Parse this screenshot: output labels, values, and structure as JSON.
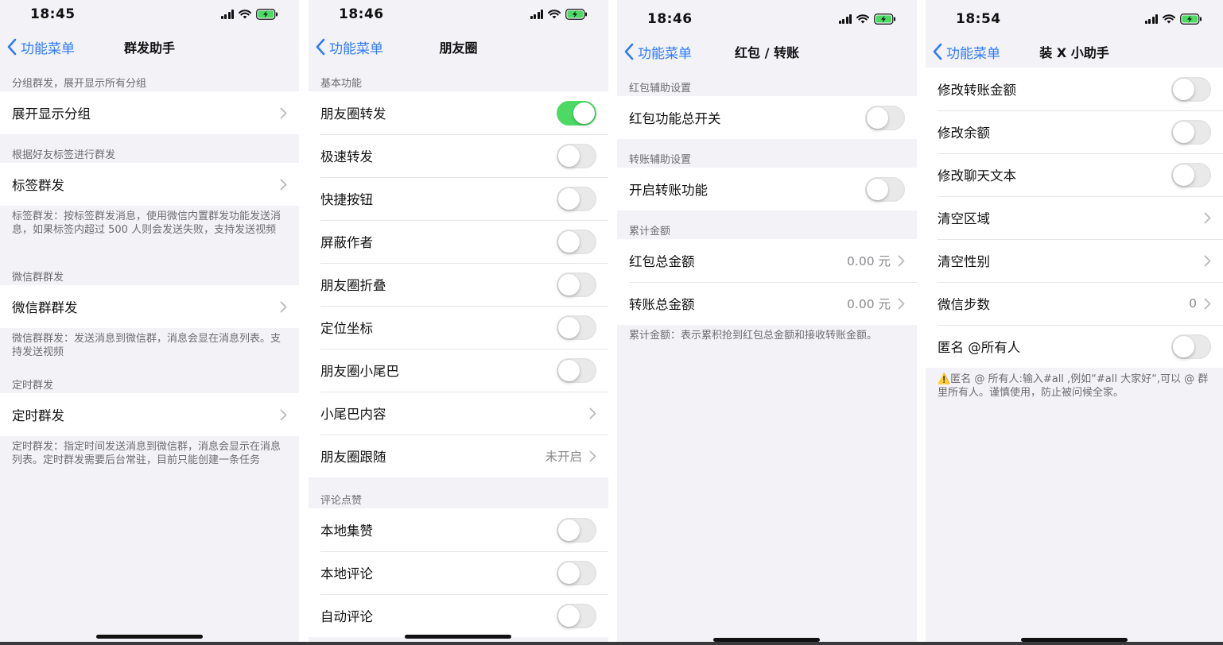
{
  "back_label": "功能菜单",
  "colors": {
    "accent_blue": "#2f7bf5",
    "toggle_on": "#4cd964",
    "toggle_off": "#e9e9ea",
    "background": "#f2f2f7"
  },
  "screen1": {
    "time": "18:45",
    "title": "群发助手",
    "header1": "分组群发，展开显示所有分组",
    "row_expand": "展开显示分组",
    "header2": "根据好友标签进行群发",
    "row_tag": "标签群发",
    "footer_tag": "标签群发：按标签群发消息，使用微信内置群发功能发送消息，如果标签内超过 500 人则会发送失败，支持发送视频",
    "header3": "微信群群发",
    "row_group": "微信群群发",
    "footer_group": "微信群群发：发送消息到微信群，消息会显在消息列表。支持发送视频",
    "header4": "定时群发",
    "row_timed": "定时群发",
    "footer_timed": "定时群发：指定时间发送消息到微信群，消息会显示在消息列表。定时群发需要后台常驻，目前只能创建一条任务"
  },
  "screen2": {
    "time": "18:46",
    "title": "朋友圈",
    "header_basic": "基本功能",
    "row_forward": "朋友圈转发",
    "forward_on": true,
    "row_fast": "极速转发",
    "row_shortcut": "快捷按钮",
    "row_block": "屏蔽作者",
    "row_fold": "朋友圈折叠",
    "row_location": "定位坐标",
    "row_tail": "朋友圈小尾巴",
    "row_tail_content": "小尾巴内容",
    "row_follow": "朋友圈跟随",
    "follow_value": "未开启",
    "header_comment": "评论点赞",
    "row_local_like": "本地集赞",
    "row_local_comment": "本地评论",
    "row_auto_comment": "自动评论"
  },
  "screen3": {
    "time": "18:46",
    "title": "红包 / 转账",
    "header_redpacket": "红包辅助设置",
    "row_redpacket_switch": "红包功能总开关",
    "header_transfer": "转账辅助设置",
    "row_transfer_switch": "开启转账功能",
    "header_total": "累计金额",
    "row_redpacket_total": "红包总金额",
    "redpacket_total_value": "0.00 元",
    "row_transfer_total": "转账总金额",
    "transfer_total_value": "0.00 元",
    "footer_total": "累计金额：表示累积抢到红包总金额和接收转账金额。"
  },
  "screen4": {
    "time": "18:54",
    "title": "装 X 小助手",
    "row_transfer_amount": "修改转账金额",
    "row_balance": "修改余额",
    "row_chat_text": "修改聊天文本",
    "row_region": "清空区域",
    "row_gender": "清空性别",
    "row_steps": "微信步数",
    "steps_value": "0",
    "row_at_all": "匿名 @所有人",
    "footer_at_all": "⚠️匿名 @ 所有人:输入#all ,例如“#all 大家好“,可以 @ 群里所有人。谨慎使用，防止被问候全家。"
  },
  "icons": {
    "back": "chevron-left-icon",
    "disclosure": "chevron-right-icon",
    "signal": "cellular-signal-icon",
    "wifi": "wifi-icon",
    "battery": "battery-charging-icon"
  }
}
